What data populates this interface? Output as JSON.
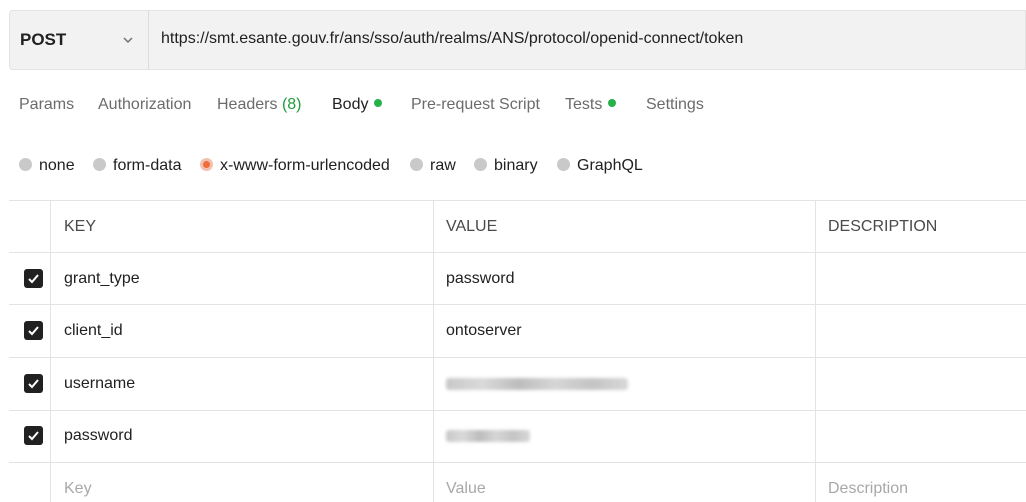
{
  "request": {
    "method": "POST",
    "url": "https://smt.esante.gouv.fr/ans/sso/auth/realms/ANS/protocol/openid-connect/token",
    "method_icon": "chevron-down-icon"
  },
  "tabs": [
    {
      "label": "Params"
    },
    {
      "label": "Authorization"
    },
    {
      "label": "Headers",
      "count": "(8)"
    },
    {
      "label": "Body",
      "indicator": "green-dot"
    },
    {
      "label": "Pre-request Script"
    },
    {
      "label": "Tests",
      "indicator": "green-dot"
    },
    {
      "label": "Settings"
    }
  ],
  "active_tab": "Body",
  "body_types": [
    {
      "label": "none"
    },
    {
      "label": "form-data"
    },
    {
      "label": "x-www-form-urlencoded",
      "selected": true
    },
    {
      "label": "raw"
    },
    {
      "label": "binary"
    },
    {
      "label": "GraphQL"
    }
  ],
  "table": {
    "headers": {
      "key": "KEY",
      "value": "VALUE",
      "description": "DESCRIPTION"
    },
    "rows": [
      {
        "checked": true,
        "key": "grant_type",
        "value": "password",
        "description": ""
      },
      {
        "checked": true,
        "key": "client_id",
        "value": "ontoserver",
        "description": ""
      },
      {
        "checked": true,
        "key": "username",
        "value": "",
        "value_redacted": true,
        "description": ""
      },
      {
        "checked": true,
        "key": "password",
        "value": "",
        "value_redacted": true,
        "description": ""
      }
    ],
    "placeholders": {
      "key": "Key",
      "value": "Value",
      "description": "Description"
    }
  },
  "colors": {
    "active_indicator": "#26b14b",
    "selected_radio": "#f26b3a",
    "headers_count": "#1f9e3a"
  }
}
